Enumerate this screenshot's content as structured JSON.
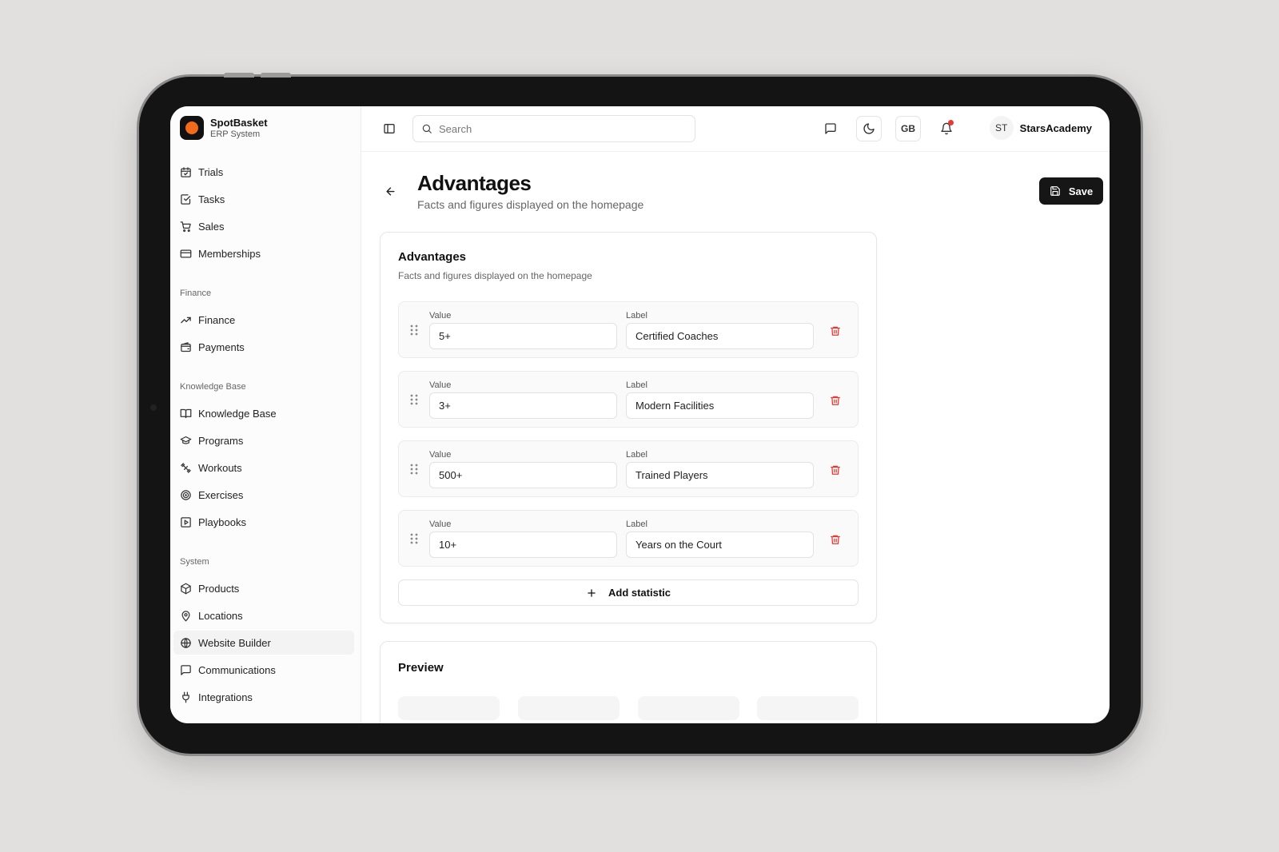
{
  "brand": {
    "name": "SpotBasket",
    "subtitle": "ERP System"
  },
  "sidebar": {
    "main_items": [
      {
        "label": "Trials",
        "icon": "calendar-check-icon"
      },
      {
        "label": "Tasks",
        "icon": "checkbox-icon"
      },
      {
        "label": "Sales",
        "icon": "cart-icon"
      },
      {
        "label": "Memberships",
        "icon": "card-icon"
      }
    ],
    "sections": [
      {
        "title": "Finance",
        "items": [
          {
            "label": "Finance",
            "icon": "trend-up-icon"
          },
          {
            "label": "Payments",
            "icon": "wallet-icon"
          }
        ]
      },
      {
        "title": "Knowledge Base",
        "items": [
          {
            "label": "Knowledge Base",
            "icon": "book-icon"
          },
          {
            "label": "Programs",
            "icon": "graduation-cap-icon"
          },
          {
            "label": "Workouts",
            "icon": "dumbbell-icon"
          },
          {
            "label": "Exercises",
            "icon": "target-icon"
          },
          {
            "label": "Playbooks",
            "icon": "play-square-icon"
          }
        ]
      },
      {
        "title": "System",
        "items": [
          {
            "label": "Products",
            "icon": "package-icon"
          },
          {
            "label": "Locations",
            "icon": "map-pin-icon"
          },
          {
            "label": "Website Builder",
            "icon": "globe-icon",
            "active": true
          },
          {
            "label": "Communications",
            "icon": "message-icon"
          },
          {
            "label": "Integrations",
            "icon": "plug-icon"
          }
        ]
      }
    ]
  },
  "topbar": {
    "search_placeholder": "Search",
    "language": "GB",
    "user_initials": "ST",
    "user_name": "StarsAcademy",
    "has_notification": true
  },
  "page": {
    "title": "Advantages",
    "subtitle": "Facts and figures displayed on the homepage",
    "save_label": "Save"
  },
  "advantages_card": {
    "title": "Advantages",
    "subtitle": "Facts and figures displayed on the homepage",
    "value_label": "Value",
    "label_label": "Label",
    "stats": [
      {
        "value": "5+",
        "label": "Certified Coaches"
      },
      {
        "value": "3+",
        "label": "Modern Facilities"
      },
      {
        "value": "500+",
        "label": "Trained Players"
      },
      {
        "value": "10+",
        "label": "Years on the Court"
      }
    ],
    "add_label": "Add statistic"
  },
  "preview_card": {
    "title": "Preview"
  },
  "colors": {
    "accent": "#f26a1b",
    "danger": "#e53935",
    "primary_button": "#161616"
  }
}
